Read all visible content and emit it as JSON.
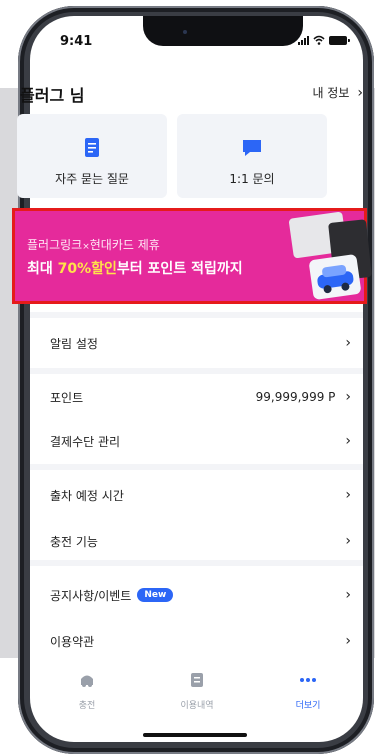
{
  "status_bar": {
    "time": "9:41"
  },
  "header": {
    "user_name": "플러그 님",
    "profile_link": "내 정보"
  },
  "quick_actions": [
    {
      "label": "자주 묻는 질문",
      "icon": "document-icon"
    },
    {
      "label": "1:1 문의",
      "icon": "chat-icon"
    }
  ],
  "banner": {
    "line1_a": "플러그링크",
    "line1_x": "×",
    "line1_b": "현대카드 제휴",
    "line2_a": "최대 ",
    "line2_highlight": "70%할인",
    "line2_b": "부터 포인트 적립까지",
    "background_color": "#e52a9b",
    "highlight_color": "#ffe24a",
    "outline_color": "#e51b1b"
  },
  "menu": {
    "notification_settings": "알림 설정",
    "points": {
      "label": "포인트",
      "value": "99,999,999 P"
    },
    "payment_methods": "결제수단 관리",
    "departure_time": "출차 예정 시간",
    "charging_feature": "충전 기능",
    "notices": {
      "label": "공지사항/이벤트",
      "badge": "New"
    },
    "terms": "이용약관"
  },
  "tab_bar": {
    "charge": "충전",
    "history": "이용내역",
    "more": "더보기",
    "active_color": "#2c66f6"
  }
}
